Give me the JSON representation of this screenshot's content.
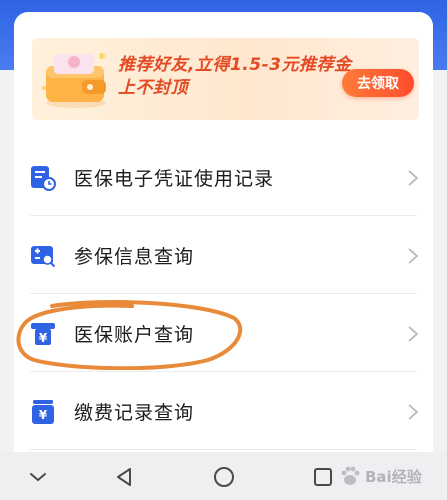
{
  "banner": {
    "text_line1": "推荐好友,立得1.5-3元推荐金",
    "text_line2": "上不封顶",
    "button_label": "去领取",
    "icon": "wallet-icon"
  },
  "menu": {
    "items": [
      {
        "label": "医保电子凭证使用记录",
        "icon": "record-clock-icon"
      },
      {
        "label": "参保信息查询",
        "icon": "insurance-search-icon"
      },
      {
        "label": "医保账户查询",
        "icon": "yuan-account-icon",
        "highlighted": true
      },
      {
        "label": "缴费记录查询",
        "icon": "yuan-payment-icon"
      }
    ]
  },
  "navbar": {
    "items": [
      "hide-chevron-icon",
      "back-triangle-icon",
      "home-circle-icon",
      "recents-square-icon"
    ]
  },
  "watermark": {
    "text": "Bai经验",
    "icon": "baidu-paw-icon"
  },
  "colors": {
    "accent_blue": "#2f63e4",
    "banner_orange": "#e44a24",
    "highlight_orange": "#e88a3a"
  }
}
